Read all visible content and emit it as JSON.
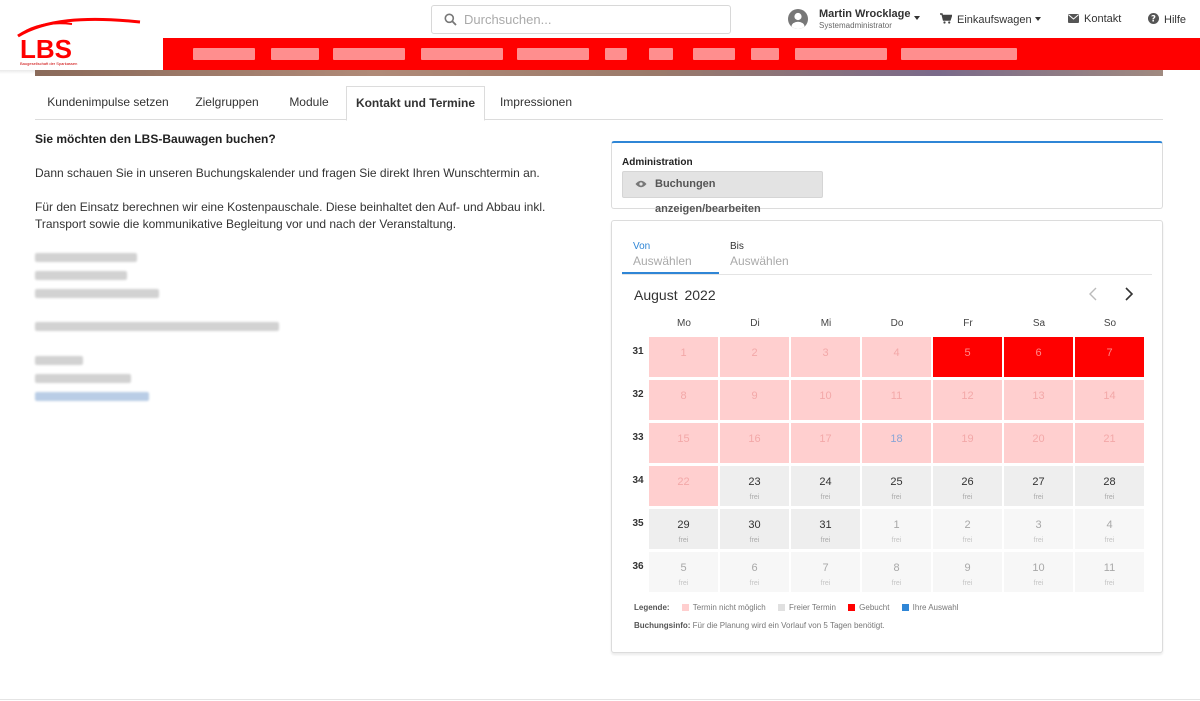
{
  "brand": {
    "logo_text": "LBS",
    "tagline": "Baugesellschaft der Sparkassen",
    "accent": "#ff0000"
  },
  "search": {
    "placeholder": "Durchsuchen..."
  },
  "user": {
    "name": "Martin Wrocklage",
    "role": "Systemadministrator"
  },
  "header_nav": {
    "cart": "Einkaufswagen",
    "contact": "Kontakt",
    "help": "Hilfe"
  },
  "tabs": [
    {
      "label": "Kundenimpulse setzen"
    },
    {
      "label": "Zielgruppen"
    },
    {
      "label": "Module"
    },
    {
      "label": "Kontakt und Termine"
    },
    {
      "label": "Impressionen"
    }
  ],
  "active_tab": "Kontakt und Termine",
  "content": {
    "title": "Sie möchten den LBS-Bauwagen buchen?",
    "p1": "Dann schauen Sie in unseren Buchungskalender und fragen Sie direkt Ihren Wunschtermin an.",
    "p2": "Für den Einsatz berechnen wir eine Kostenpauschale. Diese beinhaltet den Auf- und Abbau inkl. Transport sowie die kommunikative Begleitung vor und nach der Veranstaltung."
  },
  "admin": {
    "label": "Administration",
    "button": "Buchungen anzeigen/bearbeiten"
  },
  "calendar": {
    "from_label": "Von",
    "from_value": "Auswählen",
    "to_label": "Bis",
    "to_value": "Auswählen",
    "month": "August",
    "year": "2022",
    "weekdays": [
      "Mo",
      "Di",
      "Mi",
      "Do",
      "Fr",
      "Sa",
      "So"
    ],
    "weeks": [
      {
        "no": "31",
        "days": [
          {
            "d": "1",
            "s": "blocked",
            "t": ""
          },
          {
            "d": "2",
            "s": "blocked",
            "t": ""
          },
          {
            "d": "3",
            "s": "blocked",
            "t": ""
          },
          {
            "d": "4",
            "s": "blocked",
            "t": ""
          },
          {
            "d": "5",
            "s": "booked",
            "t": ""
          },
          {
            "d": "6",
            "s": "booked",
            "t": ""
          },
          {
            "d": "7",
            "s": "booked",
            "t": ""
          }
        ]
      },
      {
        "no": "32",
        "days": [
          {
            "d": "8",
            "s": "blocked",
            "t": ""
          },
          {
            "d": "9",
            "s": "blocked",
            "t": ""
          },
          {
            "d": "10",
            "s": "blocked",
            "t": ""
          },
          {
            "d": "11",
            "s": "blocked",
            "t": ""
          },
          {
            "d": "12",
            "s": "blocked",
            "t": ""
          },
          {
            "d": "13",
            "s": "blocked",
            "t": ""
          },
          {
            "d": "14",
            "s": "blocked",
            "t": ""
          }
        ]
      },
      {
        "no": "33",
        "days": [
          {
            "d": "15",
            "s": "blocked",
            "t": ""
          },
          {
            "d": "16",
            "s": "blocked",
            "t": ""
          },
          {
            "d": "17",
            "s": "blocked",
            "t": ""
          },
          {
            "d": "18",
            "s": "blocked hl",
            "t": ""
          },
          {
            "d": "19",
            "s": "blocked",
            "t": ""
          },
          {
            "d": "20",
            "s": "blocked",
            "t": ""
          },
          {
            "d": "21",
            "s": "blocked",
            "t": ""
          }
        ]
      },
      {
        "no": "34",
        "days": [
          {
            "d": "22",
            "s": "blocked",
            "t": ""
          },
          {
            "d": "23",
            "s": "free",
            "t": "frei"
          },
          {
            "d": "24",
            "s": "free",
            "t": "frei"
          },
          {
            "d": "25",
            "s": "free",
            "t": "frei"
          },
          {
            "d": "26",
            "s": "free",
            "t": "frei"
          },
          {
            "d": "27",
            "s": "free",
            "t": "frei"
          },
          {
            "d": "28",
            "s": "free",
            "t": "frei"
          }
        ]
      },
      {
        "no": "35",
        "days": [
          {
            "d": "29",
            "s": "free",
            "t": "frei"
          },
          {
            "d": "30",
            "s": "free",
            "t": "frei"
          },
          {
            "d": "31",
            "s": "free",
            "t": "frei"
          },
          {
            "d": "1",
            "s": "other",
            "t": "frei"
          },
          {
            "d": "2",
            "s": "other",
            "t": "frei"
          },
          {
            "d": "3",
            "s": "other",
            "t": "frei"
          },
          {
            "d": "4",
            "s": "other",
            "t": "frei"
          }
        ]
      },
      {
        "no": "36",
        "days": [
          {
            "d": "5",
            "s": "other",
            "t": "frei"
          },
          {
            "d": "6",
            "s": "other",
            "t": "frei"
          },
          {
            "d": "7",
            "s": "other",
            "t": "frei"
          },
          {
            "d": "8",
            "s": "other",
            "t": "frei"
          },
          {
            "d": "9",
            "s": "other",
            "t": "frei"
          },
          {
            "d": "10",
            "s": "other",
            "t": "frei"
          },
          {
            "d": "11",
            "s": "other",
            "t": "frei"
          }
        ]
      }
    ],
    "legend": {
      "title": "Legende:",
      "blocked": "Termin nicht möglich",
      "free": "Freier Termin",
      "booked": "Gebucht",
      "selected": "Ihre Auswahl",
      "colors": {
        "blocked": "#ffcfcf",
        "free": "#e0e0e0",
        "booked": "#ff0000",
        "selected": "#2f86d6"
      }
    },
    "info_label": "Buchungsinfo:",
    "info_text": "Für die Planung wird ein Vorlauf von 5 Tagen benötigt."
  }
}
